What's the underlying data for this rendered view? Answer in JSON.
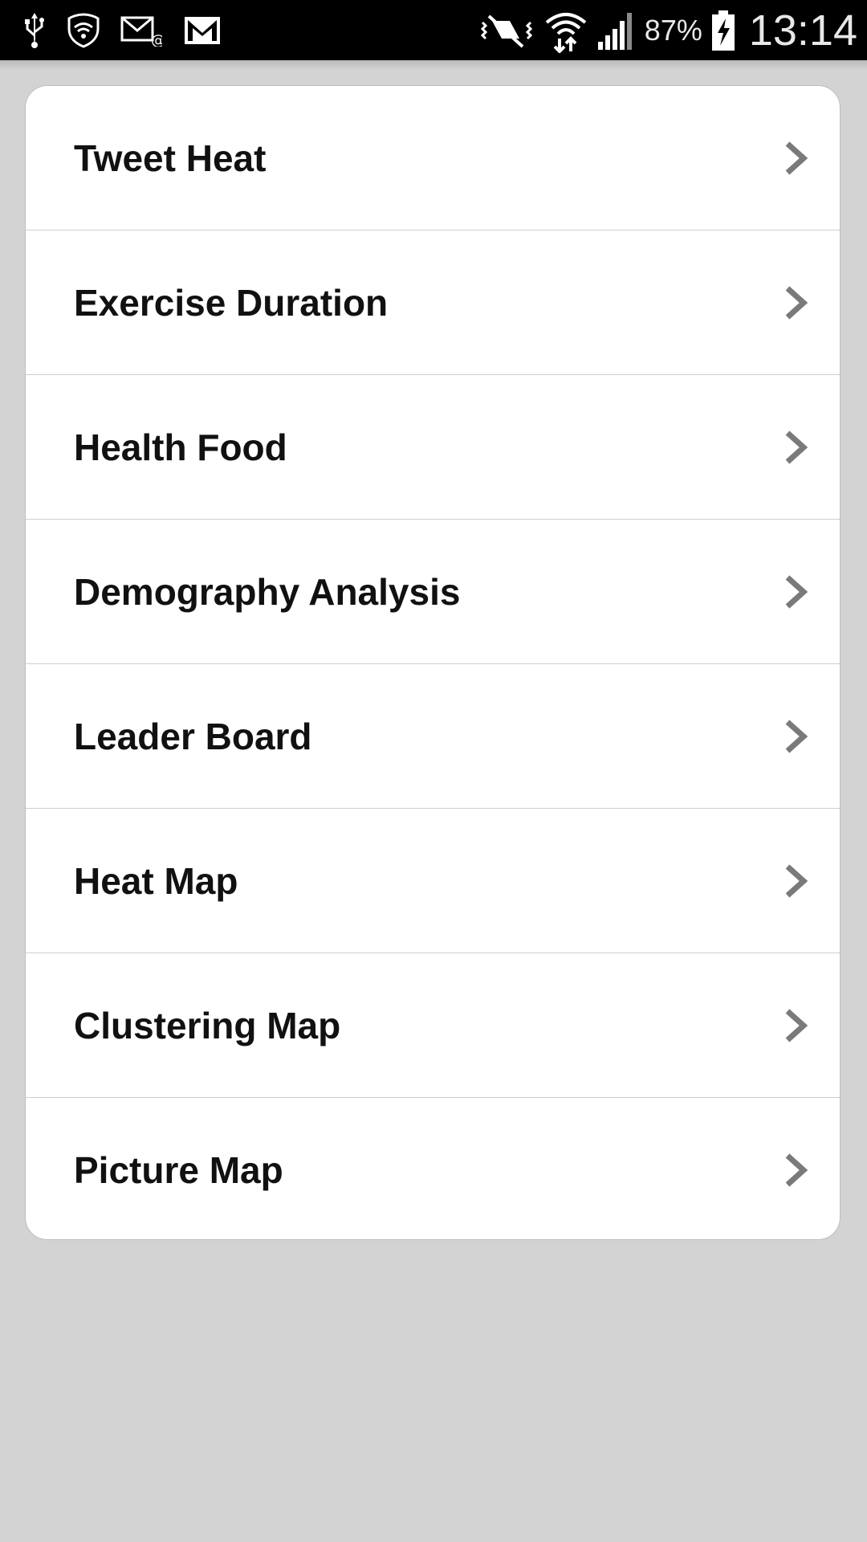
{
  "status_bar": {
    "left_icons": [
      "usb-icon",
      "shield-wifi-icon",
      "email-icon",
      "gmail-icon"
    ],
    "right_icons": [
      "vibrate-mute-icon",
      "wifi-icon",
      "signal-icon",
      "battery-charging-icon"
    ],
    "battery_percent": "87%",
    "time": "13:14"
  },
  "menu": {
    "items": [
      {
        "label": "Tweet Heat"
      },
      {
        "label": "Exercise Duration"
      },
      {
        "label": "Health Food"
      },
      {
        "label": "Demography Analysis"
      },
      {
        "label": "Leader Board"
      },
      {
        "label": "Heat Map"
      },
      {
        "label": "Clustering Map"
      },
      {
        "label": "Picture Map"
      }
    ]
  },
  "colors": {
    "background": "#d3d3d3",
    "card": "#ffffff",
    "text": "#111111",
    "chevron": "#7a7a7a",
    "status_bar": "#000000"
  }
}
